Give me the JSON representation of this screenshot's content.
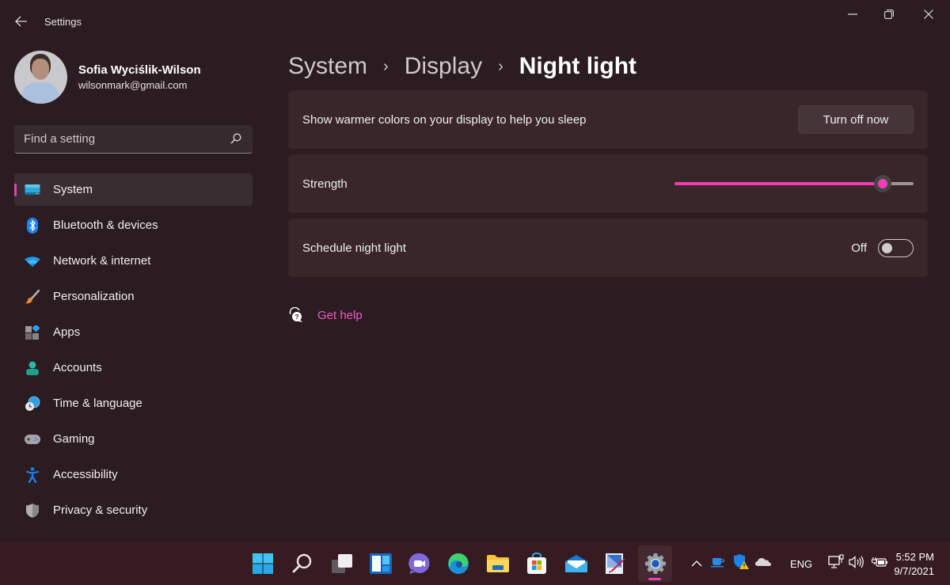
{
  "window": {
    "title": "Settings",
    "controls": [
      "minimize",
      "restore",
      "close"
    ]
  },
  "profile": {
    "name": "Sofia Wyciślik-Wilson",
    "email": "wilsonmark@gmail.com"
  },
  "search": {
    "placeholder": "Find a setting",
    "value": ""
  },
  "sidebar": {
    "items": [
      {
        "label": "System",
        "icon": "monitor-icon",
        "active": true
      },
      {
        "label": "Bluetooth & devices",
        "icon": "bluetooth-icon",
        "active": false
      },
      {
        "label": "Network & internet",
        "icon": "wifi-icon",
        "active": false
      },
      {
        "label": "Personalization",
        "icon": "paintbrush-icon",
        "active": false
      },
      {
        "label": "Apps",
        "icon": "apps-icon",
        "active": false
      },
      {
        "label": "Accounts",
        "icon": "person-icon",
        "active": false
      },
      {
        "label": "Time & language",
        "icon": "globe-clock-icon",
        "active": false
      },
      {
        "label": "Gaming",
        "icon": "gamepad-icon",
        "active": false
      },
      {
        "label": "Accessibility",
        "icon": "accessibility-icon",
        "active": false
      },
      {
        "label": "Privacy & security",
        "icon": "shield-icon",
        "active": false
      }
    ]
  },
  "breadcrumb": {
    "items": [
      "System",
      "Display"
    ],
    "current": "Night light",
    "separator": "›"
  },
  "settings": {
    "night_light": {
      "label": "Show warmer colors on your display to help you sleep",
      "button_label": "Turn off now"
    },
    "strength": {
      "label": "Strength",
      "value_fraction": 0.87
    },
    "schedule": {
      "label": "Schedule night light",
      "state_label": "Off",
      "enabled": false
    }
  },
  "help": {
    "label": "Get help"
  },
  "accent_color": "#f23cb8",
  "taskbar": {
    "apps": [
      {
        "name": "start",
        "icon": "windows-logo-icon"
      },
      {
        "name": "search",
        "icon": "search-icon"
      },
      {
        "name": "task-view",
        "icon": "task-view-icon"
      },
      {
        "name": "widgets",
        "icon": "widgets-icon"
      },
      {
        "name": "chat",
        "icon": "teams-chat-icon"
      },
      {
        "name": "edge",
        "icon": "edge-browser-icon"
      },
      {
        "name": "file-explorer",
        "icon": "folder-icon"
      },
      {
        "name": "store",
        "icon": "store-icon"
      },
      {
        "name": "mail",
        "icon": "mail-icon"
      },
      {
        "name": "paint",
        "icon": "paint-icon"
      },
      {
        "name": "settings",
        "icon": "gear-icon",
        "active": true
      }
    ],
    "tray": {
      "language": "ENG",
      "time": "5:52 PM",
      "date": "9/7/2021"
    }
  }
}
